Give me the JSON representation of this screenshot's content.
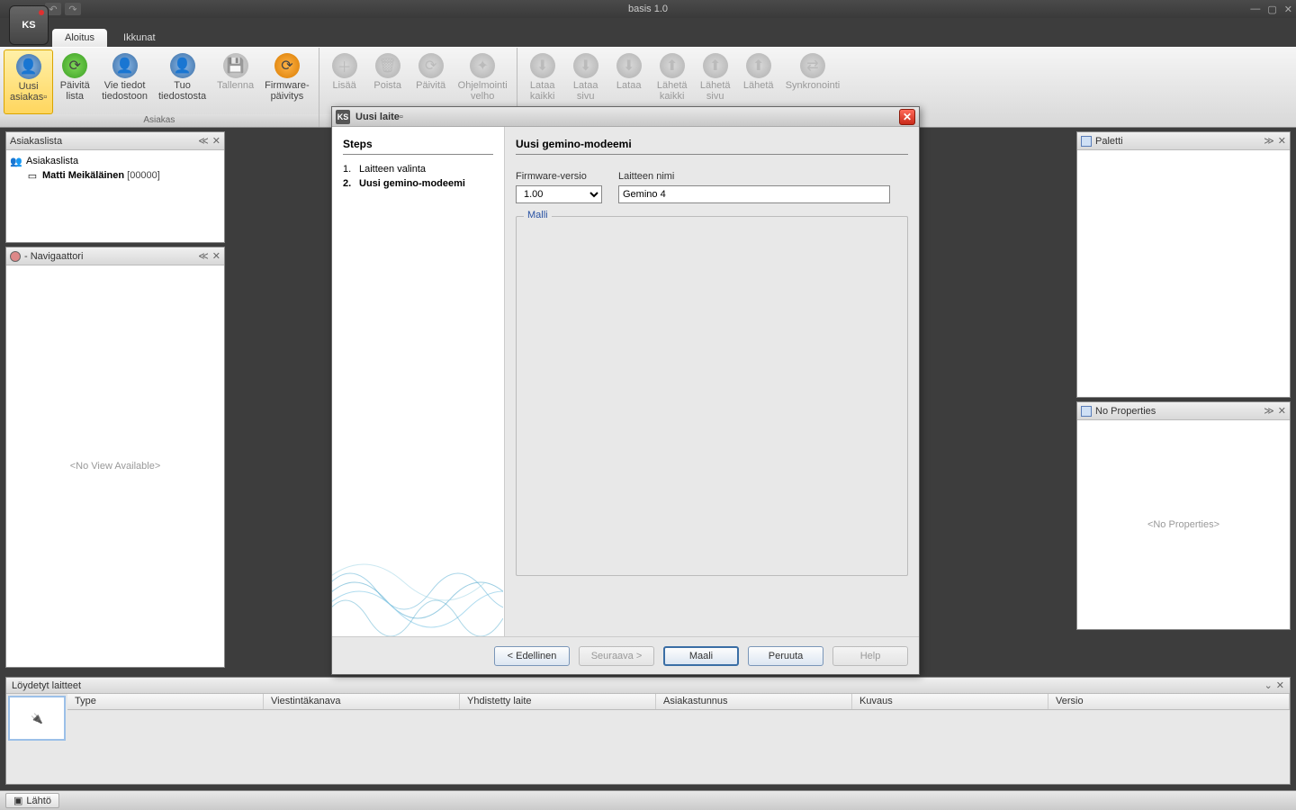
{
  "app": {
    "title": "basis 1.0",
    "logo": "KS"
  },
  "tabs": {
    "items": [
      "Aloitus",
      "Ikkunat"
    ],
    "active": 0
  },
  "ribbon": {
    "group1_label": "Asiakas",
    "btns1": [
      {
        "label1": "Uusi",
        "label2": "asiakas▫"
      },
      {
        "label1": "Päivitä",
        "label2": "lista"
      },
      {
        "label1": "Vie tiedot",
        "label2": "tiedostoon"
      },
      {
        "label1": "Tuo",
        "label2": "tiedostosta"
      },
      {
        "label1": "Tallenna",
        "label2": ""
      },
      {
        "label1": "Firmware-",
        "label2": "päivitys"
      }
    ],
    "btns2": [
      {
        "label1": "Lisää",
        "label2": ""
      },
      {
        "label1": "Poista",
        "label2": ""
      },
      {
        "label1": "Päivitä",
        "label2": ""
      },
      {
        "label1": "Ohjelmointi",
        "label2": "velho"
      }
    ],
    "btns3": [
      {
        "label1": "Lataa",
        "label2": "kaikki"
      },
      {
        "label1": "Lataa",
        "label2": "sivu"
      },
      {
        "label1": "Lataa",
        "label2": ""
      },
      {
        "label1": "Lähetä",
        "label2": "kaikki"
      },
      {
        "label1": "Lähetä",
        "label2": "sivu"
      },
      {
        "label1": "Lähetä",
        "label2": ""
      },
      {
        "label1": "Synkronointi",
        "label2": ""
      }
    ]
  },
  "panels": {
    "custlist": {
      "title": "Asiakaslista",
      "root": "Asiakaslista",
      "item_name": "Matti Meikäläinen",
      "item_code": "[00000]"
    },
    "nav": {
      "title": "- Navigaattori",
      "placeholder": "<No View Available>"
    },
    "palette": {
      "title": "Paletti"
    },
    "props": {
      "title": "No Properties",
      "placeholder": "<No Properties>"
    }
  },
  "found": {
    "title": "Löydetyt laitteet",
    "cols": [
      "Type",
      "Viestintäkanava",
      "Yhdistetty laite",
      "Asiakastunnus",
      "Kuvaus",
      "Versio"
    ]
  },
  "status": {
    "tab": "Lähtö"
  },
  "dialog": {
    "title": "Uusi laite▫",
    "steps_header": "Steps",
    "steps": [
      "Laitteen valinta",
      "Uusi gemino-modeemi"
    ],
    "current_step": 2,
    "right_header": "Uusi gemino-modeemi",
    "firmware_label": "Firmware-versio",
    "firmware_value": "1.00",
    "name_label": "Laitteen nimi",
    "name_value": "Gemino 4",
    "fieldset_label": "Malli",
    "buttons": {
      "prev": "< Edellinen",
      "next": "Seuraava >",
      "finish": "Maali",
      "cancel": "Peruuta",
      "help": "Help"
    }
  }
}
